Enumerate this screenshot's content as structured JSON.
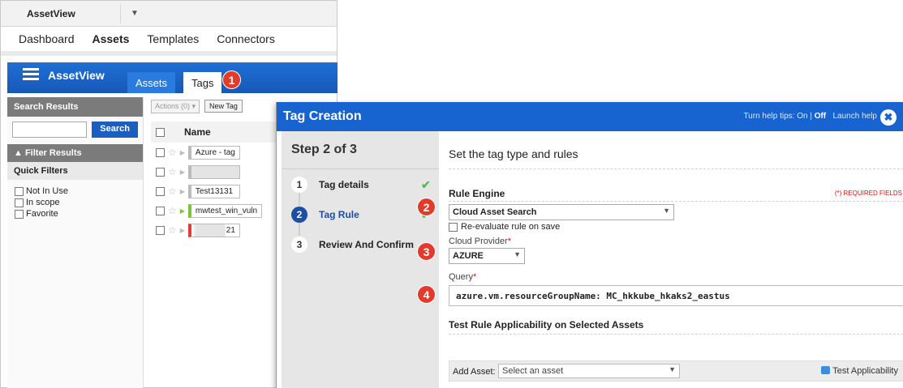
{
  "app": {
    "name": "AssetView",
    "nav": [
      "Dashboard",
      "Assets",
      "Templates",
      "Connectors"
    ],
    "module_title": "AssetView",
    "tabs": [
      "Assets",
      "Tags"
    ]
  },
  "sidebar": {
    "search_header": "Search Results",
    "search_button": "Search",
    "filter_header": "▲ Filter Results",
    "quick_filters": "Quick Filters",
    "filters": [
      "Not In Use",
      "In scope",
      "Favorite"
    ]
  },
  "grid": {
    "actions": "Actions (0) ▾",
    "new_tag": "New Tag",
    "name_header": "Name",
    "rows": [
      {
        "name": "Azure - tag",
        "color": "#bbbbbb"
      },
      {
        "name": "",
        "color": "#bbbbbb"
      },
      {
        "name": "Test13131",
        "color": "#bbbbbb"
      },
      {
        "name": "mwtest_win_vuln",
        "color": "#7ec23a"
      },
      {
        "name": "21",
        "color": "#e53935"
      }
    ]
  },
  "badges": [
    "1",
    "2",
    "3",
    "4"
  ],
  "modal": {
    "title": "Tag Creation",
    "help_prefix": "Turn help tips: On | ",
    "help_off": "Off",
    "help_launch": "Launch help",
    "close": "✖",
    "step_title": "Step 2 of 3",
    "steps": [
      {
        "num": "1",
        "label": "Tag details"
      },
      {
        "num": "2",
        "label": "Tag Rule"
      },
      {
        "num": "3",
        "label": "Review And Confirm"
      }
    ],
    "check": "✔",
    "subtitle": "Set the tag type and rules",
    "rule_engine_label": "Rule Engine",
    "required_note": "(*) REQUIRED FIELDS",
    "rule_engine_value": "Cloud Asset Search",
    "reevaluate_label": "Re-evaluate rule on save",
    "cloud_provider_label": "Cloud Provider",
    "cloud_provider_value": "AZURE",
    "query_label": "Query",
    "query_value": "azure.vm.resourceGroupName: MC_hkkube_hkaks2_eastus",
    "test_section": "Test Rule Applicability on Selected Assets",
    "add_asset_label": "Add Asset:",
    "add_asset_placeholder": "Select an asset",
    "test_button": "Test Applicability"
  },
  "colors": {
    "accent": "#1763cf",
    "badge": "#e33a2e",
    "check": "#5cb85c"
  }
}
